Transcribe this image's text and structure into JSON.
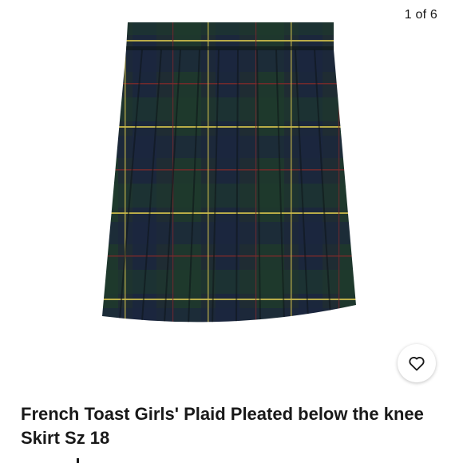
{
  "gallery": {
    "counter": "1 of 6",
    "image_subject": "green navy plaid pleated skirt"
  },
  "favorite": {
    "icon": "heart-icon"
  },
  "listing": {
    "title": "French Toast Girls' Plaid Pleated below the knee Skirt Sz 18"
  },
  "colors": {
    "plaid_base": "#1f2c33",
    "plaid_green": "#1d3b2b",
    "stripe_yellow": "#c9b94a",
    "stripe_red": "#7a2a2a"
  }
}
